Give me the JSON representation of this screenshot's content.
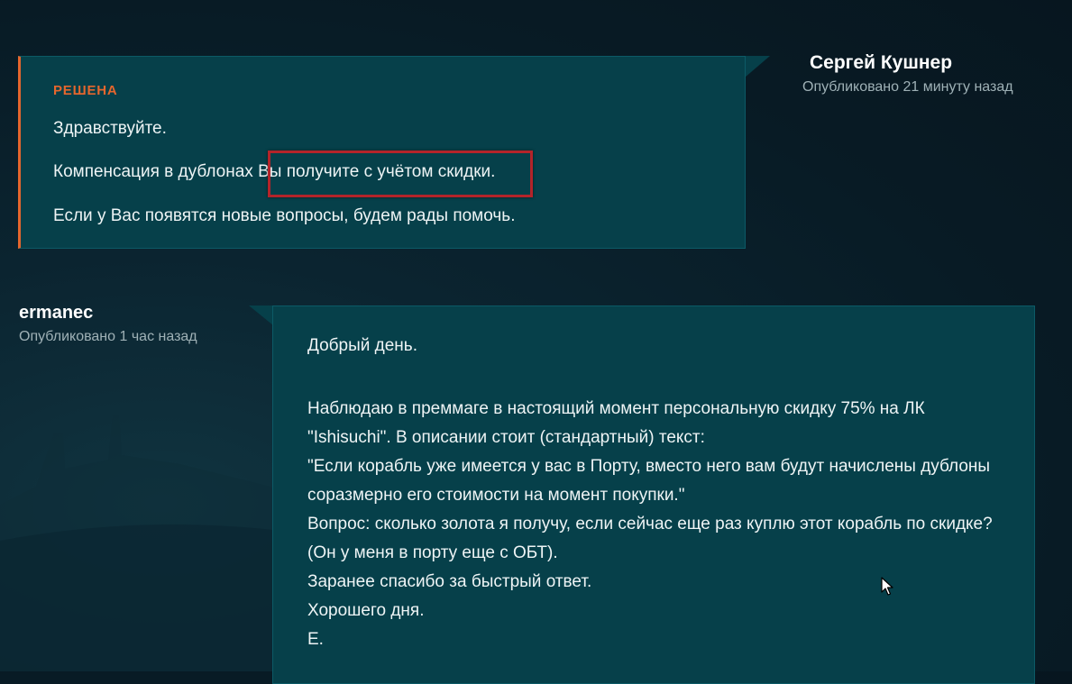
{
  "reply": {
    "author": "Сергей Кушнер",
    "published": "Опубликовано 21 минуту назад",
    "status": "РЕШЕНА",
    "greeting": "Здравствуйте.",
    "compensation_prefix": "Компенсация в дублонах ",
    "compensation_highlight": "Вы получите с учётом скидки.",
    "closing": "Если у Вас появятся новые вопросы, будем рады помочь.",
    "accent_color": "#e5662d",
    "highlight_color": "#b3242a"
  },
  "question": {
    "author": "ermanec",
    "published": "Опубликовано 1 час назад",
    "lines": [
      "Добрый день.",
      "Наблюдаю в преммаге в настоящий момент персональную скидку 75% на ЛК \"Ishisuchi\". В описании стоит (стандартный) текст:",
      "\"Если корабль уже имеется у вас в Порту, вместо него вам будут начислены дублоны соразмерно его стоимости на момент покупки.\"",
      "Вопрос: сколько золота я получу, если сейчас еще раз куплю этот корабль по скидке? (Он у меня в порту еще с ОБТ).",
      "Заранее спасибо за быстрый ответ.",
      "Хорошего дня.",
      "Е."
    ]
  },
  "theme": {
    "card_background": "#06404a",
    "page_background": "#081b25"
  },
  "icons": {
    "cursor": "mouse-pointer-icon"
  }
}
